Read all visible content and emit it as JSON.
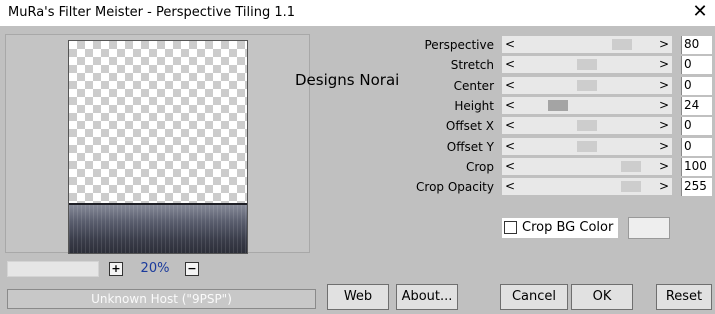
{
  "window": {
    "title": "MuRa's Filter Meister - Perspective Tiling 1.1",
    "close_glyph": "✕"
  },
  "watermark": "Designs Norai",
  "zoom": {
    "plus_label": "+",
    "minus_label": "−",
    "value": "20%"
  },
  "host": "Unknown Host (\"9PSP\")",
  "sliders": [
    {
      "label": "Perspective",
      "value": "80",
      "level": 0.8
    },
    {
      "label": "Stretch",
      "value": "0",
      "level": 0.5
    },
    {
      "label": "Center",
      "value": "0",
      "level": 0.5
    },
    {
      "label": "Height",
      "value": "24",
      "level": 0.25
    },
    {
      "label": "Offset X",
      "value": "0",
      "level": 0.5
    },
    {
      "label": "Offset Y",
      "value": "0",
      "level": 0.5
    },
    {
      "label": "Crop",
      "value": "100",
      "level": 0.87
    },
    {
      "label": "Crop Opacity",
      "value": "255",
      "level": 0.87
    }
  ],
  "arrows": {
    "left": "<",
    "right": ">"
  },
  "crop_bg": {
    "label": "Crop BG Color",
    "checked": false
  },
  "buttons": {
    "web": "Web",
    "about": "About...",
    "cancel": "Cancel",
    "ok": "OK",
    "reset": "Reset"
  },
  "colors": {
    "background": "#c0c0c0",
    "zoom_text": "#1a3a9c"
  }
}
